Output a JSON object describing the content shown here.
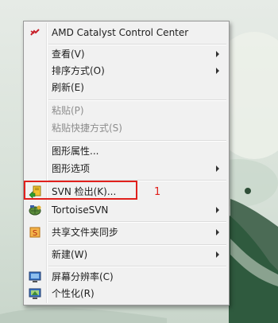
{
  "menu": {
    "items": {
      "amd": {
        "label": "AMD Catalyst Control Center",
        "icon": "amd-catalyst-icon"
      },
      "view": {
        "label": "查看(V)"
      },
      "sort": {
        "label": "排序方式(O)"
      },
      "refresh": {
        "label": "刷新(E)"
      },
      "paste": {
        "label": "粘贴(P)"
      },
      "paste_shortcut": {
        "label": "粘贴快捷方式(S)"
      },
      "graphics_props": {
        "label": "图形属性..."
      },
      "graphics_opts": {
        "label": "图形选项"
      },
      "svn_checkout": {
        "label": "SVN 检出(K)...",
        "icon": "svn-checkout-icon"
      },
      "tortoise": {
        "label": "TortoiseSVN",
        "icon": "tortoisesvn-icon"
      },
      "share_sync": {
        "label": "共享文件夹同步",
        "icon": "share-sync-icon"
      },
      "new": {
        "label": "新建(W)"
      },
      "resolution": {
        "label": "屏幕分辨率(C)",
        "icon": "monitor-icon"
      },
      "personalize": {
        "label": "个性化(R)",
        "icon": "personalize-icon"
      }
    }
  },
  "annotation": {
    "number": "1"
  },
  "colors": {
    "highlight": "#e0201c",
    "menu_bg": "#f1f1f1"
  }
}
